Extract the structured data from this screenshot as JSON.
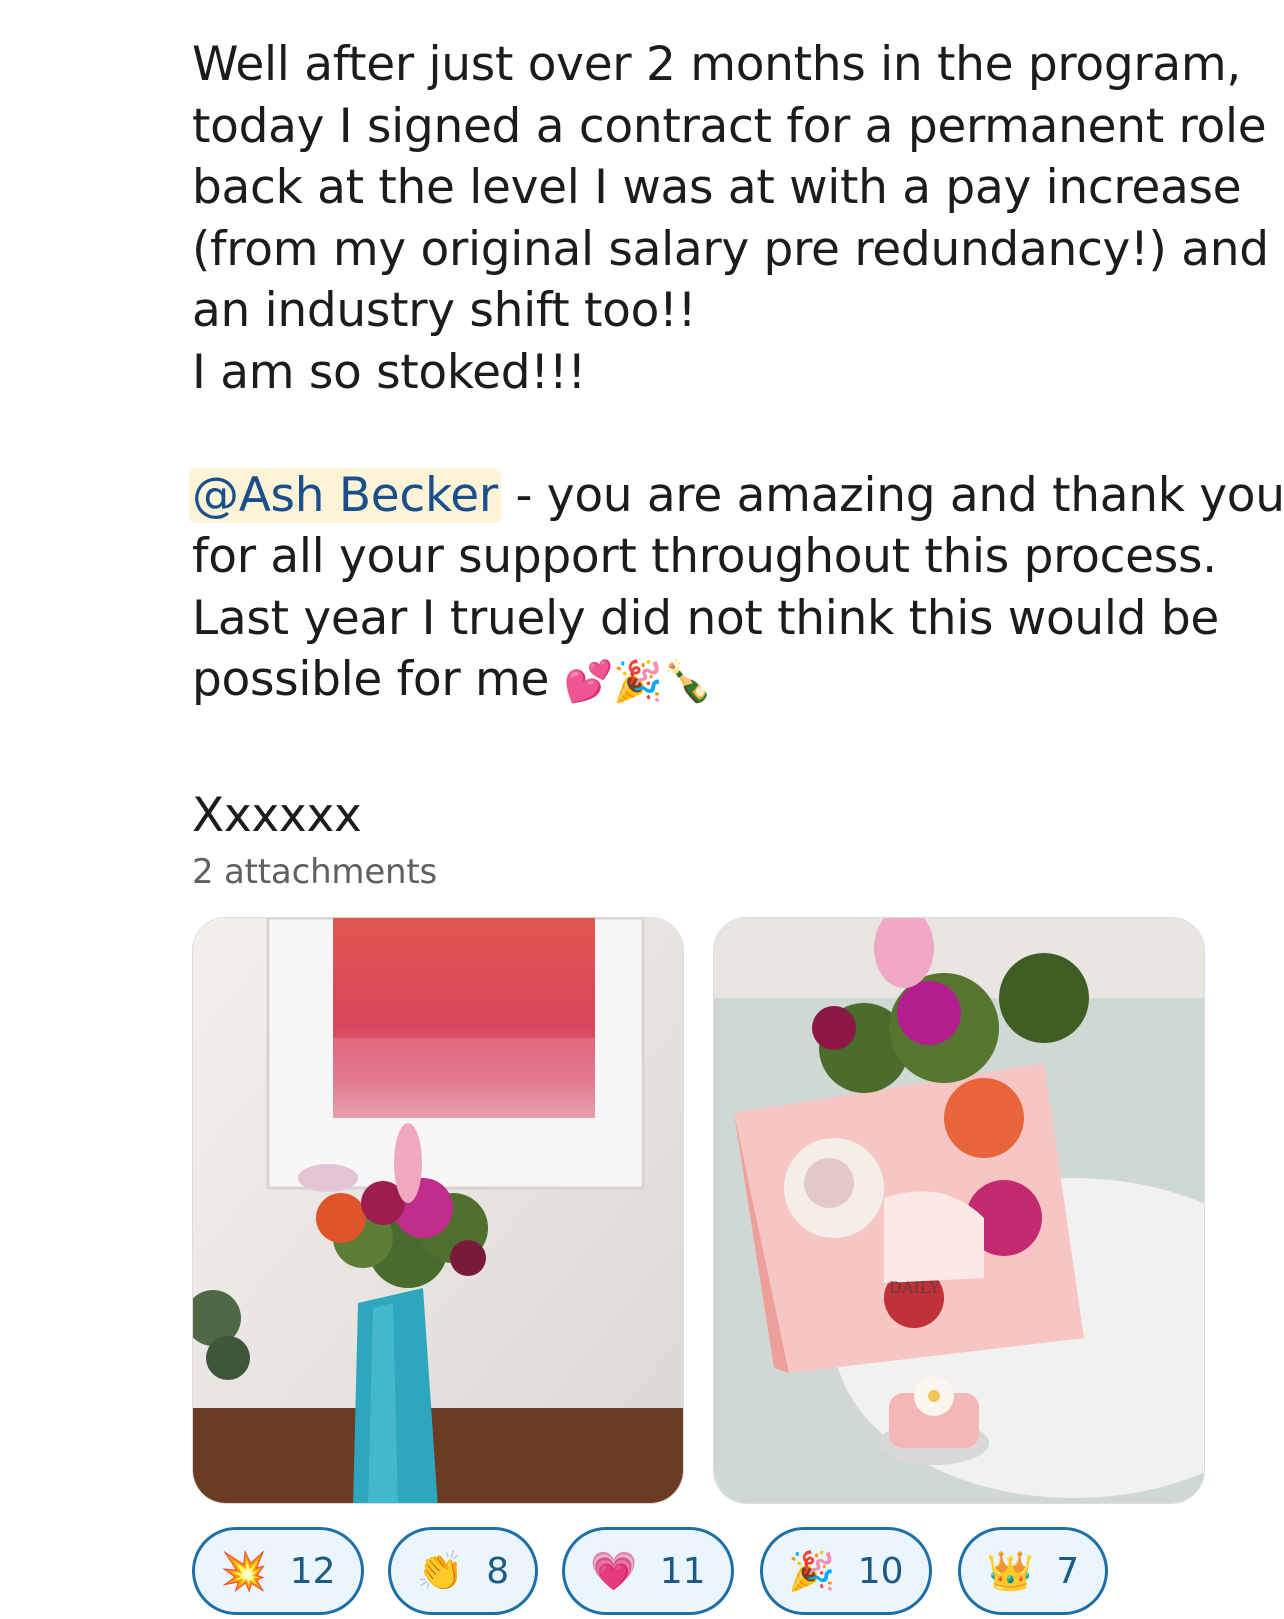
{
  "message": {
    "lines": [
      "Well after just over 2 months in the program,",
      "today I signed a contract for a permanent role",
      "back at the level I was at with a pay increase",
      "(from my original salary pre redundancy!) and",
      "an industry shift too!!",
      "I am so stoked!!!"
    ],
    "mention": "@Ash Becker",
    "mention_rest": " - you are amazing and thank you",
    "lines2": [
      "for all your support throughout this process.",
      "Last year I truely did not think this would be"
    ],
    "last_line": "possible for me ",
    "emojis": "💕🎉🍾",
    "signoff": "Xxxxxx"
  },
  "attachments": {
    "label": "2 attachments"
  },
  "reactions": [
    {
      "emoji": "💥",
      "count": "12"
    },
    {
      "emoji": "👏",
      "count": "8"
    },
    {
      "emoji": "💗",
      "count": "11"
    },
    {
      "emoji": "🎉",
      "count": "10"
    },
    {
      "emoji": "👑",
      "count": "7"
    }
  ]
}
